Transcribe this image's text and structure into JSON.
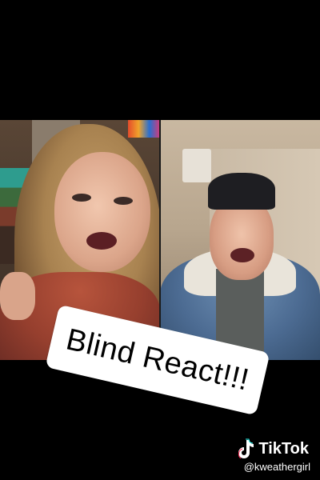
{
  "caption": {
    "text": "Blind React!!!"
  },
  "watermark": {
    "brand": "TikTok",
    "handle": "@kweathergirl",
    "icon": "tiktok-note-icon"
  },
  "colors": {
    "background": "#000000",
    "caption_bg": "#ffffff",
    "caption_text": "#000000",
    "watermark_text": "#ffffff"
  }
}
